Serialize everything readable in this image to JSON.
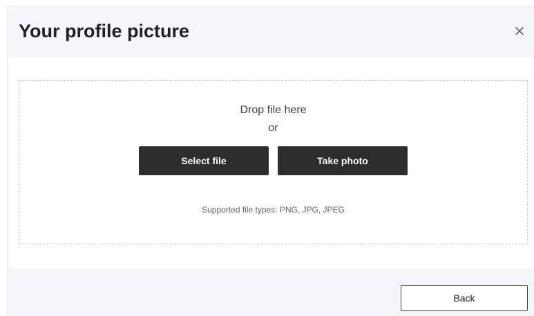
{
  "dialog": {
    "title": "Your profile picture",
    "close_icon": "close-icon"
  },
  "dropzone": {
    "drop_text": "Drop file here",
    "or_text": "or",
    "select_file_label": "Select file",
    "take_photo_label": "Take photo",
    "supported_types": "Supported file types: PNG, JPG, JPEG"
  },
  "footer": {
    "back_label": "Back"
  },
  "colors": {
    "header_bg": "#f5f6f8",
    "button_dark": "#2d2d2d",
    "dash_border": "#c8cacd"
  }
}
